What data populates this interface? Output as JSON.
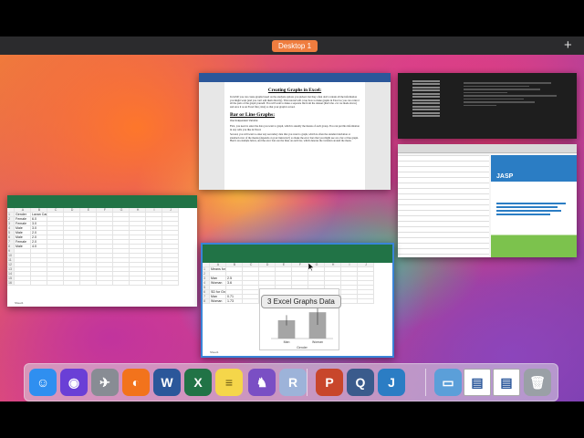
{
  "mission_control": {
    "space_label": "Desktop 1",
    "add_space_symbol": "+"
  },
  "word_doc": {
    "title": "Creating Graphs in Excel:",
    "intro": "In JASP, you can create graphs based on the analysis options you picked, but they often don't contain all the information you might want (and you can't edit them directly). This tutorial will cover how to make graphs in Excel so you can control all the parts of the graph yourself. You will want to make a separate file from the dataset (that's the .csv we made above) and save it as an Excel file (.xlsx) so that your graph is saved.",
    "heading": "Bar or Line Graphs:",
    "subheading": "One Independent Variable:",
    "para1": "First, you need to enter the data you want to graph, which is usually the means of each group. You can put this information in any cells you like in Excel.",
    "para2": "Second, you will want to enter any secondary data that you want to graph, which is often the standard deviation or standard error of the means (depends on your instructor!) so make the error bars that you might see on a bar or line graph. Here's an example below, and the error bars are the lines on each bar, which denotes the variation around the mean."
  },
  "jasp": {
    "logo_text": "JASP"
  },
  "excel_left": {
    "columns": [
      "",
      "A",
      "B",
      "C",
      "D",
      "E",
      "F",
      "G",
      "H",
      "I",
      "J"
    ],
    "rows": [
      [
        "1",
        "Gender",
        "Lavan Care",
        "",
        "",
        "",
        "",
        "",
        "",
        "",
        ""
      ],
      [
        "2",
        "Female",
        "6.0",
        "",
        "",
        "",
        "",
        "",
        "",
        "",
        ""
      ],
      [
        "3",
        "Female",
        "3.0",
        "",
        "",
        "",
        "",
        "",
        "",
        "",
        ""
      ],
      [
        "4",
        "Male",
        "3.0",
        "",
        "",
        "",
        "",
        "",
        "",
        "",
        ""
      ],
      [
        "5",
        "Male",
        "2.0",
        "",
        "",
        "",
        "",
        "",
        "",
        "",
        ""
      ],
      [
        "6",
        "Male",
        "2.0",
        "",
        "",
        "",
        "",
        "",
        "",
        "",
        ""
      ],
      [
        "7",
        "Female",
        "2.0",
        "",
        "",
        "",
        "",
        "",
        "",
        "",
        ""
      ],
      [
        "8",
        "Male",
        "4.0",
        "",
        "",
        "",
        "",
        "",
        "",
        "",
        ""
      ],
      [
        "9",
        "",
        "",
        "",
        "",
        "",
        "",
        "",
        "",
        "",
        ""
      ],
      [
        "10",
        "",
        "",
        "",
        "",
        "",
        "",
        "",
        "",
        "",
        ""
      ],
      [
        "11",
        "",
        "",
        "",
        "",
        "",
        "",
        "",
        "",
        "",
        ""
      ],
      [
        "12",
        "",
        "",
        "",
        "",
        "",
        "",
        "",
        "",
        "",
        ""
      ],
      [
        "13",
        "",
        "",
        "",
        "",
        "",
        "",
        "",
        "",
        "",
        ""
      ],
      [
        "14",
        "",
        "",
        "",
        "",
        "",
        "",
        "",
        "",
        "",
        ""
      ],
      [
        "15",
        "",
        "",
        "",
        "",
        "",
        "",
        "",
        "",
        "",
        ""
      ],
      [
        "16",
        "",
        "",
        "",
        "",
        "",
        "",
        "",
        "",
        "",
        ""
      ]
    ],
    "sheet_tab": "Sheet1"
  },
  "excel_main": {
    "window_label": "3 Excel Graphs Data",
    "columns": [
      "",
      "A",
      "B",
      "C",
      "D",
      "E",
      "F",
      "G",
      "H",
      "I",
      "J"
    ],
    "rows": [
      [
        "1",
        "Means for Groups",
        "",
        "",
        "",
        "",
        "",
        "",
        "",
        "",
        ""
      ],
      [
        "2",
        "",
        "",
        "",
        "",
        "",
        "",
        "",
        "",
        "",
        ""
      ],
      [
        "3",
        "Man",
        "2.5",
        "",
        "",
        "",
        "",
        "",
        "",
        "",
        ""
      ],
      [
        "4",
        "Woman",
        "3.6",
        "",
        "",
        "",
        "",
        "",
        "",
        "",
        ""
      ],
      [
        "5",
        "",
        "",
        "",
        "",
        "",
        "",
        "",
        "",
        "",
        ""
      ],
      [
        "6",
        "SD for Groups",
        "",
        "",
        "",
        "",
        "",
        "",
        "",
        "",
        ""
      ],
      [
        "7",
        "Man",
        "0.71",
        "",
        "",
        "",
        "",
        "",
        "",
        "",
        ""
      ],
      [
        "8",
        "Woman",
        "1.73",
        "",
        "",
        "",
        "",
        "",
        "",
        "",
        ""
      ]
    ],
    "chart": {
      "categories": [
        "Man",
        "Woman"
      ],
      "values": [
        2.5,
        3.6
      ],
      "errors": [
        0.71,
        1.73
      ],
      "xlabel": "Gender",
      "ylim": [
        0,
        6
      ]
    },
    "sheet_tab": "Sheet1"
  },
  "dock": {
    "icons": [
      {
        "name": "finder-icon",
        "color": "#2f8ff0",
        "glyph": "☺"
      },
      {
        "name": "siri-icon",
        "color": "#6a3fd6",
        "glyph": "◉"
      },
      {
        "name": "launchpad-icon",
        "color": "#888c94",
        "glyph": "✈"
      },
      {
        "name": "firefox-icon",
        "color": "#f2731c",
        "glyph": "◐"
      },
      {
        "name": "word-icon",
        "color": "#2b579a",
        "glyph": "W"
      },
      {
        "name": "excel-icon",
        "color": "#217346",
        "glyph": "X"
      },
      {
        "name": "notes-icon",
        "color": "#f5d64a",
        "glyph": "≡"
      },
      {
        "name": "github-icon",
        "color": "#7a4fc4",
        "glyph": "♞"
      },
      {
        "name": "r-icon",
        "color": "#9db3d9",
        "glyph": "R"
      },
      {
        "name": "powerpoint-icon",
        "color": "#c8462b",
        "glyph": "P"
      },
      {
        "name": "quicktime-icon",
        "color": "#3a5b8c",
        "glyph": "Q"
      },
      {
        "name": "jasp-icon",
        "color": "#2b7dc4",
        "glyph": "J"
      },
      {
        "name": "downloads-folder-icon",
        "color": "#5b9fd9",
        "glyph": "▭"
      },
      {
        "name": "document-stack-icon",
        "color": "#ffffff",
        "glyph": "▤"
      },
      {
        "name": "document-stack-2-icon",
        "color": "#ffffff",
        "glyph": "▤"
      },
      {
        "name": "trash-icon",
        "color": "#9aa0a6",
        "glyph": "🗑"
      }
    ]
  }
}
